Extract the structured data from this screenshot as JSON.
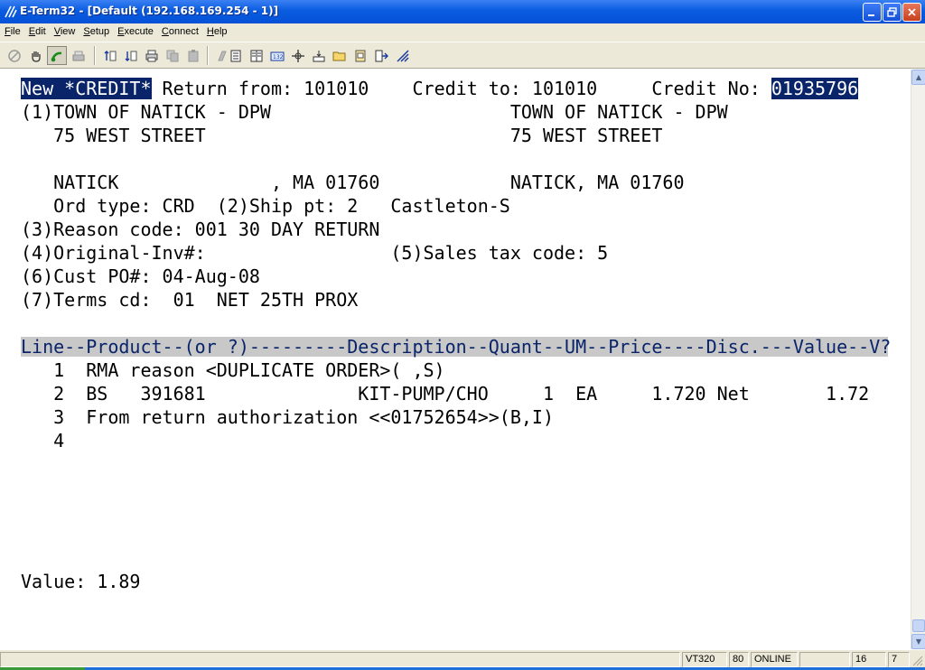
{
  "window": {
    "title": "E-Term32 - [Default (192.168.169.254 - 1)]"
  },
  "menu": [
    "File",
    "Edit",
    "View",
    "Setup",
    "Execute",
    "Connect",
    "Help"
  ],
  "toolbar_icons": [
    "disconnect-icon",
    "hand-icon",
    "connect-icon",
    "print-screen-icon",
    "transfer-up-icon",
    "transfer-down-icon",
    "printer-icon",
    "copy-icon",
    "paste-icon",
    "blank-icon",
    "page-icon",
    "columns-icon",
    "number-icon",
    "cross-icon",
    "tray-icon",
    "folder-icon",
    "clipboard-icon",
    "exit-icon",
    "resize-icon"
  ],
  "terminal": {
    "header_inverse": "New *CREDIT*",
    "header_return": " Return from: 101010    Credit to: 101010     Credit No: ",
    "credit_no": "01935796",
    "line1": "(1)TOWN OF NATICK - DPW                      TOWN OF NATICK - DPW",
    "line2": "   75 WEST STREET                            75 WEST STREET",
    "line3": "   NATICK              , MA 01760            NATICK, MA 01760",
    "line4": "   Ord type: CRD  (2)Ship pt: 2   Castleton-S",
    "line5": "(3)Reason code: 001 30 DAY RETURN",
    "line6": "(4)Original-Inv#:                 (5)Sales tax code: 5",
    "line7": "(6)Cust PO#: 04-Aug-08",
    "line8": "(7)Terms cd:  01  NET 25TH PROX",
    "columns_header": "Line--Product--(or ?)---------Description--Quant--UM--Price----Disc.---Value--V?",
    "items": [
      "   1  RMA reason <DUPLICATE ORDER>( ,S)",
      "   2  BS   391681              KIT-PUMP/CHO     1  EA     1.720 Net       1.72",
      "   3  From return authorization <<01752654>>(B,I)",
      "   4"
    ],
    "value_line": "Value: 1.89"
  },
  "status": {
    "terminal_type": "VT320",
    "columns": "80",
    "state": "ONLINE",
    "row": "16",
    "col": "7"
  }
}
